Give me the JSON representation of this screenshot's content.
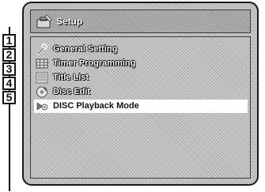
{
  "window": {
    "title": "Setup",
    "title_icon": "setup-toolbox-icon"
  },
  "menu": {
    "items": [
      {
        "label": "General Setting",
        "icon": "wrench-icon",
        "callout": "1"
      },
      {
        "label": "Timer Programming",
        "icon": "timer-grid-icon",
        "callout": "2"
      },
      {
        "label": "Title List",
        "icon": "title-list-icon",
        "callout": "3"
      },
      {
        "label": "Disc Edit",
        "icon": "disc-edit-icon",
        "callout": "4"
      },
      {
        "label": "DISC Playback Mode",
        "icon": "disc-playback-icon",
        "callout": "5",
        "selected": true
      }
    ]
  },
  "colors": {
    "screen_bg": "#bdbdbd",
    "selection_bg": "#ffffff",
    "text_normal": "#ffffff",
    "text_selected": "#111111"
  }
}
